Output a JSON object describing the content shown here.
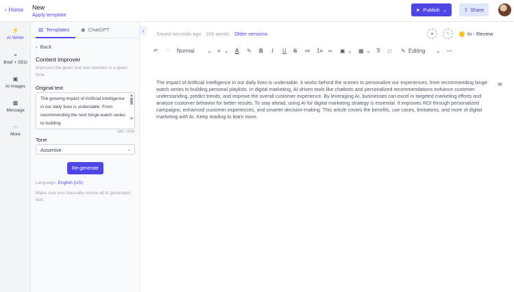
{
  "header": {
    "home_label": "Home",
    "doc_title": "New",
    "apply_template": "Apply template",
    "publish_label": "Publish",
    "share_label": "Share",
    "accent": "#4f46e5"
  },
  "rail": {
    "items": [
      {
        "label": "AI Writer",
        "icon": "lightning-icon"
      },
      {
        "label": "Brief + SEO",
        "icon": "target-icon"
      },
      {
        "label": "AI Images",
        "icon": "image-icon"
      },
      {
        "label": "Message",
        "icon": "message-icon"
      },
      {
        "label": "More",
        "icon": "ellipsis-icon"
      }
    ]
  },
  "panel": {
    "tabs": [
      {
        "label": "Templates"
      },
      {
        "label": "ChatGPT"
      }
    ],
    "back_label": "Back",
    "title": "Content improver",
    "description": "Improves the given text and rewrites in a given tone.",
    "original_label": "Original text",
    "original_value": "The growing impact of Artificial Intelligence in our daily lives is undeniable. From recommending the next binge-watch series to building",
    "char_count": "988 / 3000",
    "tone_label": "Tone",
    "tone_value": "Assertive",
    "regenerate_label": "Re-generate",
    "language_label": "Language:",
    "language_value": "English (US)",
    "note": "Make sure you manually review all AI generated text."
  },
  "editor": {
    "saved_text": "Saved seconds ago",
    "word_count": "109 words",
    "older_versions": "Older versions",
    "status_label": "In - Review",
    "style_value": "Normal",
    "mode_value": "Editing",
    "body": "The impact of Artificial Intelligence in our daily lives is undeniable. It works behind the scenes to personalize our experiences, from recommending binge-watch series to building personal playlists. In digital marketing, AI-driven tools like chatbots and personalized recommendations enhance customer understanding, predict trends, and improve the overall customer experience. By leveraging AI, businesses can excel in targeted marketing efforts and analyze customer behavior for better results. To stay ahead, using AI for digital marketing strategy is essential. It improves ROI through personalized campaigns, enhanced customer experiences, and smarter decision-making. This article covers the benefits, use cases, limitations, and more of digital marketing with AI. Keep reading to learn more."
  }
}
